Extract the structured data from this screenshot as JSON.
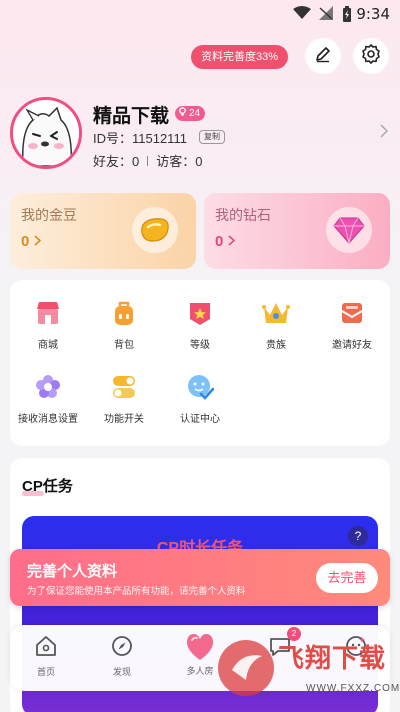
{
  "status_bar": {
    "time": "9:34"
  },
  "header": {
    "completeness": "资料完善度33%"
  },
  "profile": {
    "name": "精品下载",
    "level": "24",
    "user_id": "ID号：11512111",
    "copy_label": "复制",
    "friends": "好友：0",
    "visitors": "访客：0"
  },
  "wallet": {
    "gold": {
      "label": "我的金豆",
      "value": "0"
    },
    "diamond": {
      "label": "我的钻石",
      "value": "0"
    }
  },
  "features": [
    {
      "label": "商城",
      "icon": "shop-icon",
      "color": "#f0506e"
    },
    {
      "label": "背包",
      "icon": "backpack-icon",
      "color": "#f5a030"
    },
    {
      "label": "等级",
      "icon": "level-icon",
      "color": "#f0506e"
    },
    {
      "label": "贵族",
      "icon": "crown-icon",
      "color": "#f5b82e"
    },
    {
      "label": "邀请好友",
      "icon": "invite-icon",
      "color": "#f06a50"
    },
    {
      "label": "接收消息设置",
      "icon": "flower-settings-icon",
      "color": "#9b7cf5"
    },
    {
      "label": "功能开关",
      "icon": "toggle-icon",
      "color": "#f5b82e"
    },
    {
      "label": "认证中心",
      "icon": "verify-icon",
      "color": "#4aa3f5"
    }
  ],
  "cp": {
    "title": "CP任务",
    "card_title": "CP时长任务",
    "help": "?"
  },
  "banner": {
    "title": "完善个人资料",
    "subtitle": "为了保证您能使用本产品所有功能，请完善个人资料",
    "button": "去完善"
  },
  "nav": {
    "items": [
      {
        "label": "首页",
        "icon": "home-icon"
      },
      {
        "label": "发现",
        "icon": "compass-icon"
      },
      {
        "label": "多人房",
        "icon": "heart-icon"
      },
      {
        "label": "",
        "icon": "message-icon",
        "badge": "2"
      },
      {
        "label": "",
        "icon": "profile-icon"
      }
    ]
  },
  "watermark": {
    "text": "飞翔下载",
    "url": "WWW.FXXZ.COM"
  }
}
